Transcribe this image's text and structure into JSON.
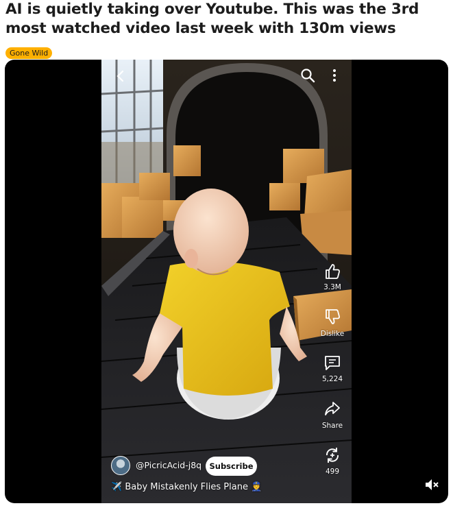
{
  "post": {
    "title": "AI is quietly taking over Youtube. This was the 3rd most watched video last week with 130m views",
    "flair": "Gone Wild",
    "flair_color": "#ffb000"
  },
  "video": {
    "channel": "@PicricAcid-j8q",
    "subscribe_label": "Subscribe",
    "video_title": "✈️ Baby Mistakenly Flies Plane 👮",
    "actions": {
      "like_count": "3.3M",
      "dislike_label": "Dislike",
      "comment_count": "5,224",
      "share_label": "Share",
      "remix_count": "499"
    },
    "icons": [
      "back-icon",
      "search-icon",
      "more-vertical-icon",
      "like-icon",
      "dislike-icon",
      "comment-icon",
      "share-icon",
      "remix-icon",
      "muted-speaker-icon"
    ]
  }
}
